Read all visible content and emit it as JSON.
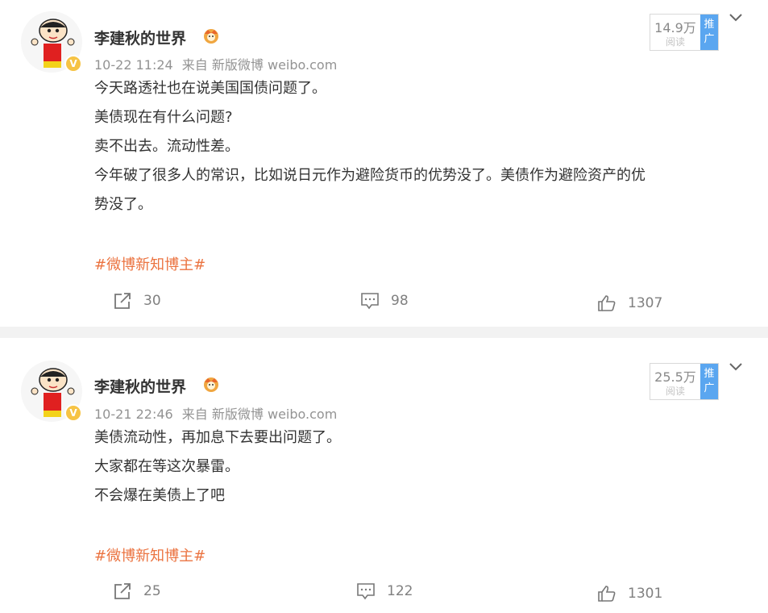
{
  "posts": [
    {
      "author": "李建秋的世界",
      "time": "10-22 11:24",
      "source_prefix": "来自",
      "source": "新版微博 weibo.com",
      "lines": [
        "今天路透社也在说美国国债问题了。",
        "美债现在有什么问题?",
        "卖不出去。流动性差。",
        "今年破了很多人的常识，比如说日元作为避险货币的优势没了。美债作为避险资产的优",
        "势没了。"
      ],
      "topic": "#微博新知博主#",
      "reads": "14.9万",
      "reads_label": "阅读",
      "ad_label": "推广",
      "reposts": "30",
      "comments": "98",
      "likes": "1307"
    },
    {
      "author": "李建秋的世界",
      "time": "10-21 22:46",
      "source_prefix": "来自",
      "source": "新版微博 weibo.com",
      "lines": [
        "美债流动性，再加息下去要出问题了。",
        "大家都在等这次暴雷。",
        "不会爆在美债上了吧"
      ],
      "topic": "#微博新知博主#",
      "reads": "25.5万",
      "reads_label": "阅读",
      "ad_label": "推广",
      "reposts": "25",
      "comments": "122",
      "likes": "1301"
    }
  ],
  "icons": {
    "repost": "repost-icon",
    "comment": "comment-icon",
    "like": "thumbs-up-icon",
    "more": "chevron-down-icon",
    "verified": "verified-v-icon",
    "crown": "vip-crown-icon"
  },
  "colors": {
    "topic": "#eb7340",
    "ad_badge": "#5aa6f0",
    "verified": "#f6c344"
  }
}
